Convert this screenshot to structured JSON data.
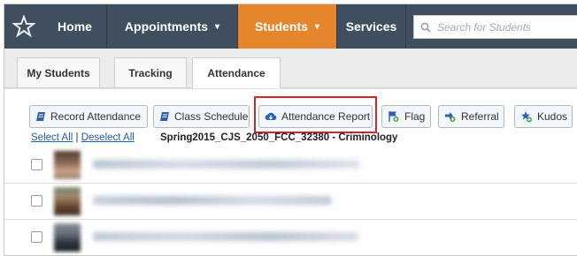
{
  "nav": {
    "items": [
      {
        "label": "Home"
      },
      {
        "label": "Appointments",
        "caret": "▾"
      },
      {
        "label": "Students",
        "caret": "▾"
      },
      {
        "label": "Services"
      }
    ],
    "search_placeholder": "Search for Students"
  },
  "tabs": [
    {
      "label": "My Students"
    },
    {
      "label": "Tracking"
    },
    {
      "label": "Attendance"
    }
  ],
  "toolbar": {
    "record_attendance": "Record Attendance",
    "class_schedule": "Class Schedule",
    "attendance_report": "Attendance Report",
    "flag": "Flag",
    "referral": "Referral",
    "kudos": "Kudos"
  },
  "selection": {
    "select_all": "Select All",
    "separator": "|",
    "deselect_all": "Deselect All"
  },
  "course_title": "Spring2015_CJS_2050_FCC_32380 - Criminology",
  "colors": {
    "nav_bg": "#3f4f5f",
    "active_accent": "#e6862c",
    "highlight": "#d9232a",
    "button_icon": "#2a62b3"
  },
  "icons": {
    "logo": "star-logo-icon",
    "search": "search-icon",
    "record_attendance": "notebook-icon",
    "class_schedule": "notebook-icon",
    "attendance_report": "cloud-download-icon",
    "flag": "flag-plus-icon",
    "referral": "arrow-plus-icon",
    "kudos": "star-plus-icon"
  }
}
